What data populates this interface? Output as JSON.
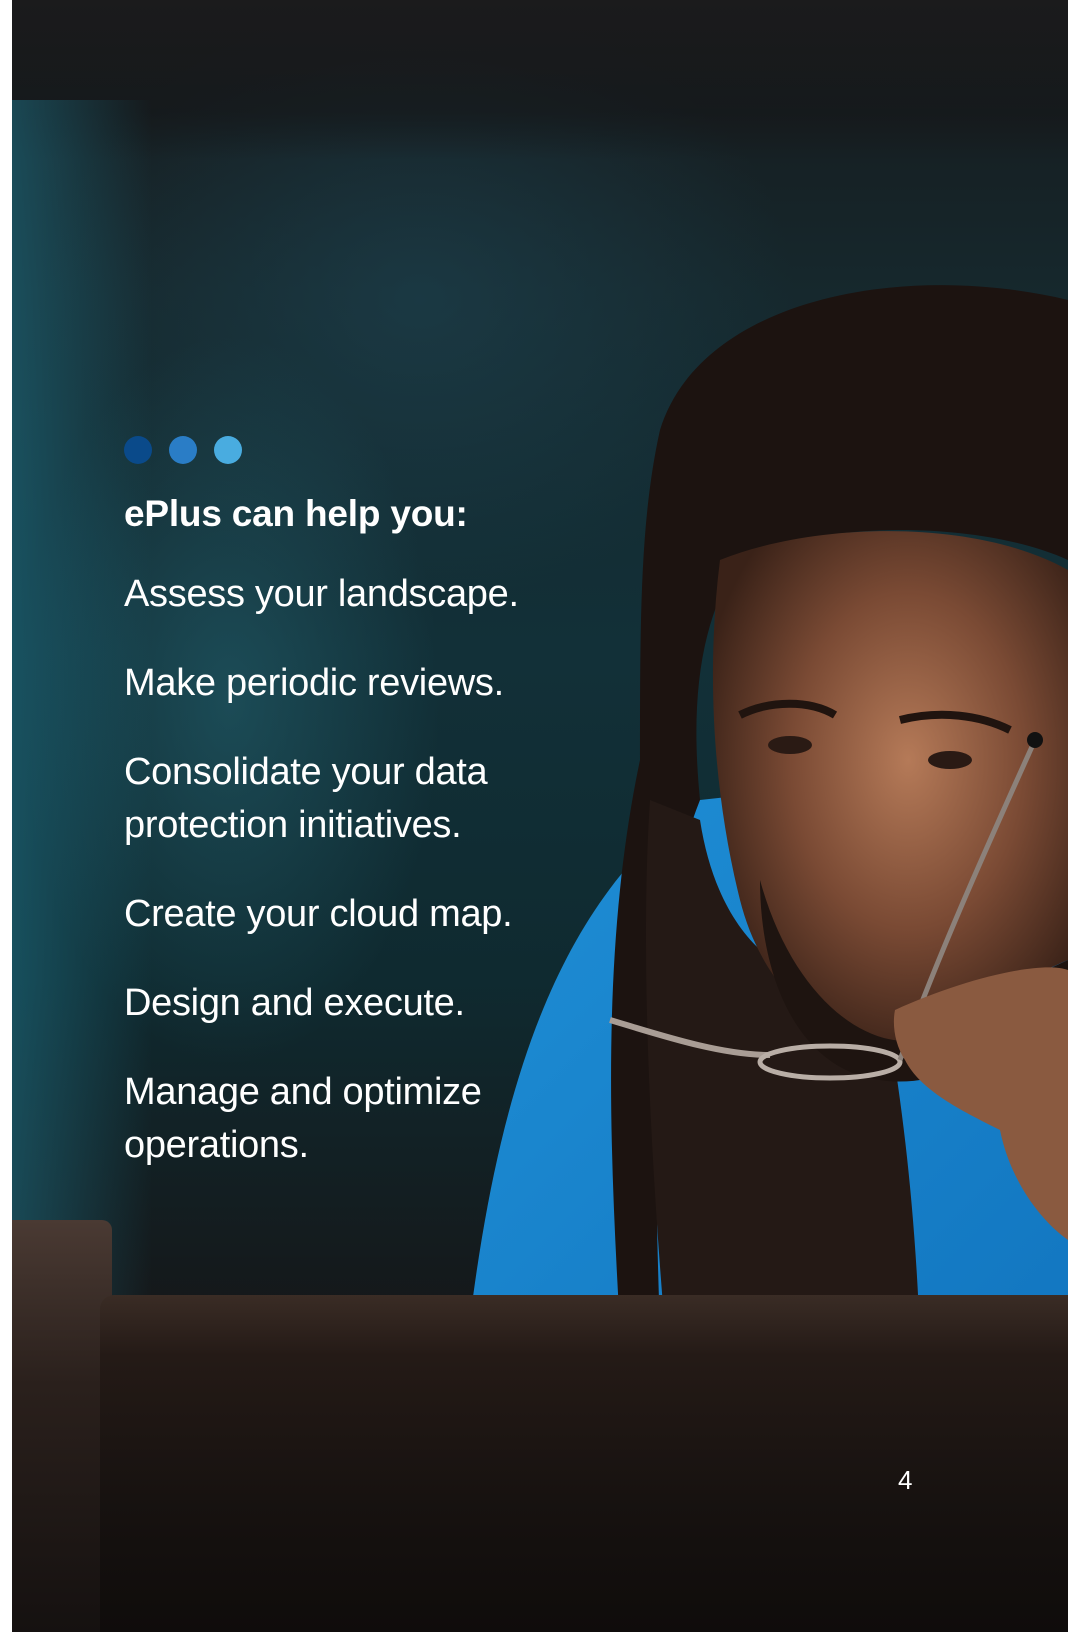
{
  "decor": {
    "dot_colors": [
      "#0a4a8a",
      "#2a7dc6",
      "#49ace0"
    ],
    "photo": "man-with-glasses-looking-at-laptop"
  },
  "heading": "ePlus can help you:",
  "items": [
    "Assess your landscape.",
    "Make periodic reviews.",
    "Consolidate your data protection initiatives.",
    "Create your cloud map.",
    "Design and execute.",
    "Manage and optimize operations."
  ],
  "page_number": "4"
}
